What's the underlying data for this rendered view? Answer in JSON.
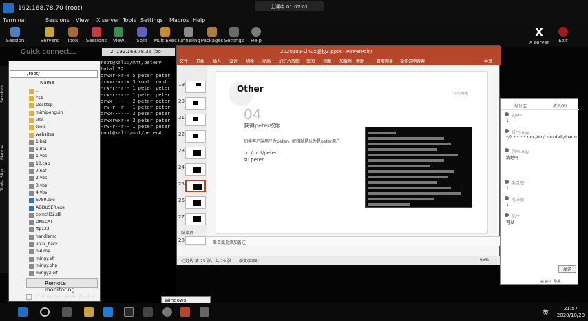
{
  "moba": {
    "title": "192.168.78.70 (root)",
    "recording_badge": "上课中 01:07:01",
    "menu": [
      "Terminal",
      "Sessions",
      "View",
      "X server",
      "Tools",
      "Settings",
      "Macros",
      "Help"
    ],
    "toolbar": [
      "Session",
      "Servers",
      "Tools",
      "Sessions",
      "View",
      "Split",
      "MultiExec",
      "Tunneling",
      "Packages",
      "Settings",
      "Help"
    ],
    "right_toolbar": [
      "X server",
      "Exit"
    ],
    "quick_connect_placeholder": "Quick connect...",
    "tab_label": "2. 192.168.78.36 (bo",
    "side_tabs": [
      "Sessions",
      "Tools",
      "Macros",
      "Sftp"
    ],
    "sftp_path": "/root/",
    "sftp_column": "Name",
    "files": [
      {
        "name": "..",
        "type": "folder"
      },
      {
        "name": "cs4",
        "type": "folder"
      },
      {
        "name": "Desktop",
        "type": "folder"
      },
      {
        "name": "mimipenguin",
        "type": "folder"
      },
      {
        "name": "test",
        "type": "folder"
      },
      {
        "name": "tools",
        "type": "folder"
      },
      {
        "name": "websites",
        "type": "folder"
      },
      {
        "name": "1.bat",
        "type": "file"
      },
      {
        "name": "1.hta",
        "type": "file"
      },
      {
        "name": "1.vbs",
        "type": "file"
      },
      {
        "name": "10.cap",
        "type": "file"
      },
      {
        "name": "2.bat",
        "type": "file"
      },
      {
        "name": "2.vbs",
        "type": "file"
      },
      {
        "name": "3.vbs",
        "type": "file"
      },
      {
        "name": "4.vbs",
        "type": "file"
      },
      {
        "name": "6789.exe",
        "type": "app"
      },
      {
        "name": "ADDUSER.exe",
        "type": "app"
      },
      {
        "name": "comctl32.dll",
        "type": "file"
      },
      {
        "name": "DNSCAT",
        "type": "file"
      },
      {
        "name": "ftp123",
        "type": "file"
      },
      {
        "name": "handler.rc",
        "type": "file"
      },
      {
        "name": "linux_back",
        "type": "file"
      },
      {
        "name": "nul.mp",
        "type": "file"
      },
      {
        "name": "mingy.elf",
        "type": "file"
      },
      {
        "name": "mingy.php",
        "type": "file"
      },
      {
        "name": "mingy2.elf",
        "type": "file"
      }
    ],
    "remote_monitoring": "Remote monitoring",
    "follow_terminal": "Follow terminal folder"
  },
  "terminal": {
    "lines": [
      "root@kali:/mnt/peter#",
      "total 32",
      "drwxr-xr-x 5 peter peter",
      "drwxr-xr-x 3 root  root",
      "-rw-r--r-- 1 peter peter",
      "-rw-r--r-- 1 peter peter",
      "drwx------ 2 peter peter",
      "-rw-r--r-- 1 peter peter",
      "drwx------ 3 peter peter",
      "drwxrwxr-x 3 peter peter",
      "-rw-r--r-- 1 peter peter",
      "root@kali:/mnt/peter#"
    ]
  },
  "ppt": {
    "title": "2020103-Linux提权3.pptx - PowerPoint",
    "ribbon": [
      "文件",
      "开始",
      "插入",
      "设计",
      "切换",
      "动画",
      "幻灯片放映",
      "审阅",
      "视图",
      "加载项",
      "帮助",
      "百度网盘",
      "操作说明搜索",
      "共享"
    ],
    "slide_numbers": [
      "19",
      "20",
      "21",
      "22",
      "23",
      "24",
      "25",
      "26",
      "27",
      "28"
    ],
    "section_label": "结束页",
    "slide": {
      "heading": "Other",
      "number": "04",
      "subtitle": "获得peter权限",
      "description": "切换客户端用户为peter，解释就是从为是peter用户",
      "cmd1": "cd /mnt/peter",
      "cmd2": "su peter",
      "logo_text": "公司标志"
    },
    "notes_placeholder": "单击此处添加备注",
    "status_slide": "幻灯片 第 25 张，共 29 张",
    "status_lang": "中文(中国)",
    "zoom": "65%"
  },
  "chat": {
    "tabs": [
      "讨论区",
      "成员(8)"
    ],
    "messages": [
      {
        "user": "刘***",
        "text": "1"
      },
      {
        "user": "张*ningy",
        "text": "*/1 * * * * root/etc/cron.daily/backup"
      },
      {
        "user": "张*ningy",
        "text": "清楚吗"
      },
      {
        "user": "毛泽熙",
        "text": "1"
      },
      {
        "user": "毛泽熙",
        "text": "1"
      },
      {
        "user": "陈**",
        "text": "可以"
      }
    ],
    "send_label": "发送",
    "footer_label": "禁言中...联系..."
  },
  "tooltip": "Windows Terminal",
  "clock": {
    "time": "21:57",
    "date": "2020/10/20"
  },
  "ime": "英",
  "colors": {
    "ppt_accent": "#b7472a",
    "moba_blue": "#1d6fc4",
    "exit_red": "#a21b1b"
  }
}
